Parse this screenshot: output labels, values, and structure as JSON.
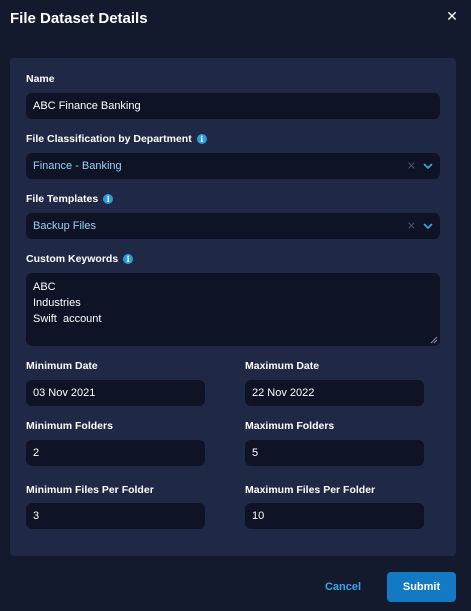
{
  "dialog": {
    "title": "File Dataset Details",
    "close_icon": "close-icon"
  },
  "form": {
    "name": {
      "label": "Name",
      "value": "ABC Finance Banking"
    },
    "classification": {
      "label": "File Classification by Department",
      "value": "Finance - Banking",
      "clear_icon": "clear-x-icon",
      "dropdown_icon": "chevron-down-icon"
    },
    "templates": {
      "label": "File Templates",
      "value": "Backup Files",
      "clear_icon": "clear-x-icon",
      "dropdown_icon": "chevron-down-icon"
    },
    "keywords": {
      "label": "Custom Keywords",
      "lines": [
        "ABC",
        "Industries",
        "Swift  account"
      ]
    },
    "min_date": {
      "label": "Minimum Date",
      "value": "03 Nov 2021"
    },
    "max_date": {
      "label": "Maximum Date",
      "value": "22 Nov 2022"
    },
    "min_folders": {
      "label": "Minimum Folders",
      "value": "2"
    },
    "max_folders": {
      "label": "Maximum Folders",
      "value": "5"
    },
    "min_files": {
      "label": "Minimum Files Per Folder",
      "value": "3"
    },
    "max_files": {
      "label": "Maximum Files Per Folder",
      "value": "10"
    }
  },
  "actions": {
    "cancel_label": "Cancel",
    "submit_label": "Submit"
  },
  "colors": {
    "background": "#141a2e",
    "panel": "#1f2845",
    "input": "#0e1326",
    "accent": "#1479c5",
    "link": "#3aa7e8",
    "select_text": "#9ccff5",
    "info_icon": "#2d9cdb"
  }
}
